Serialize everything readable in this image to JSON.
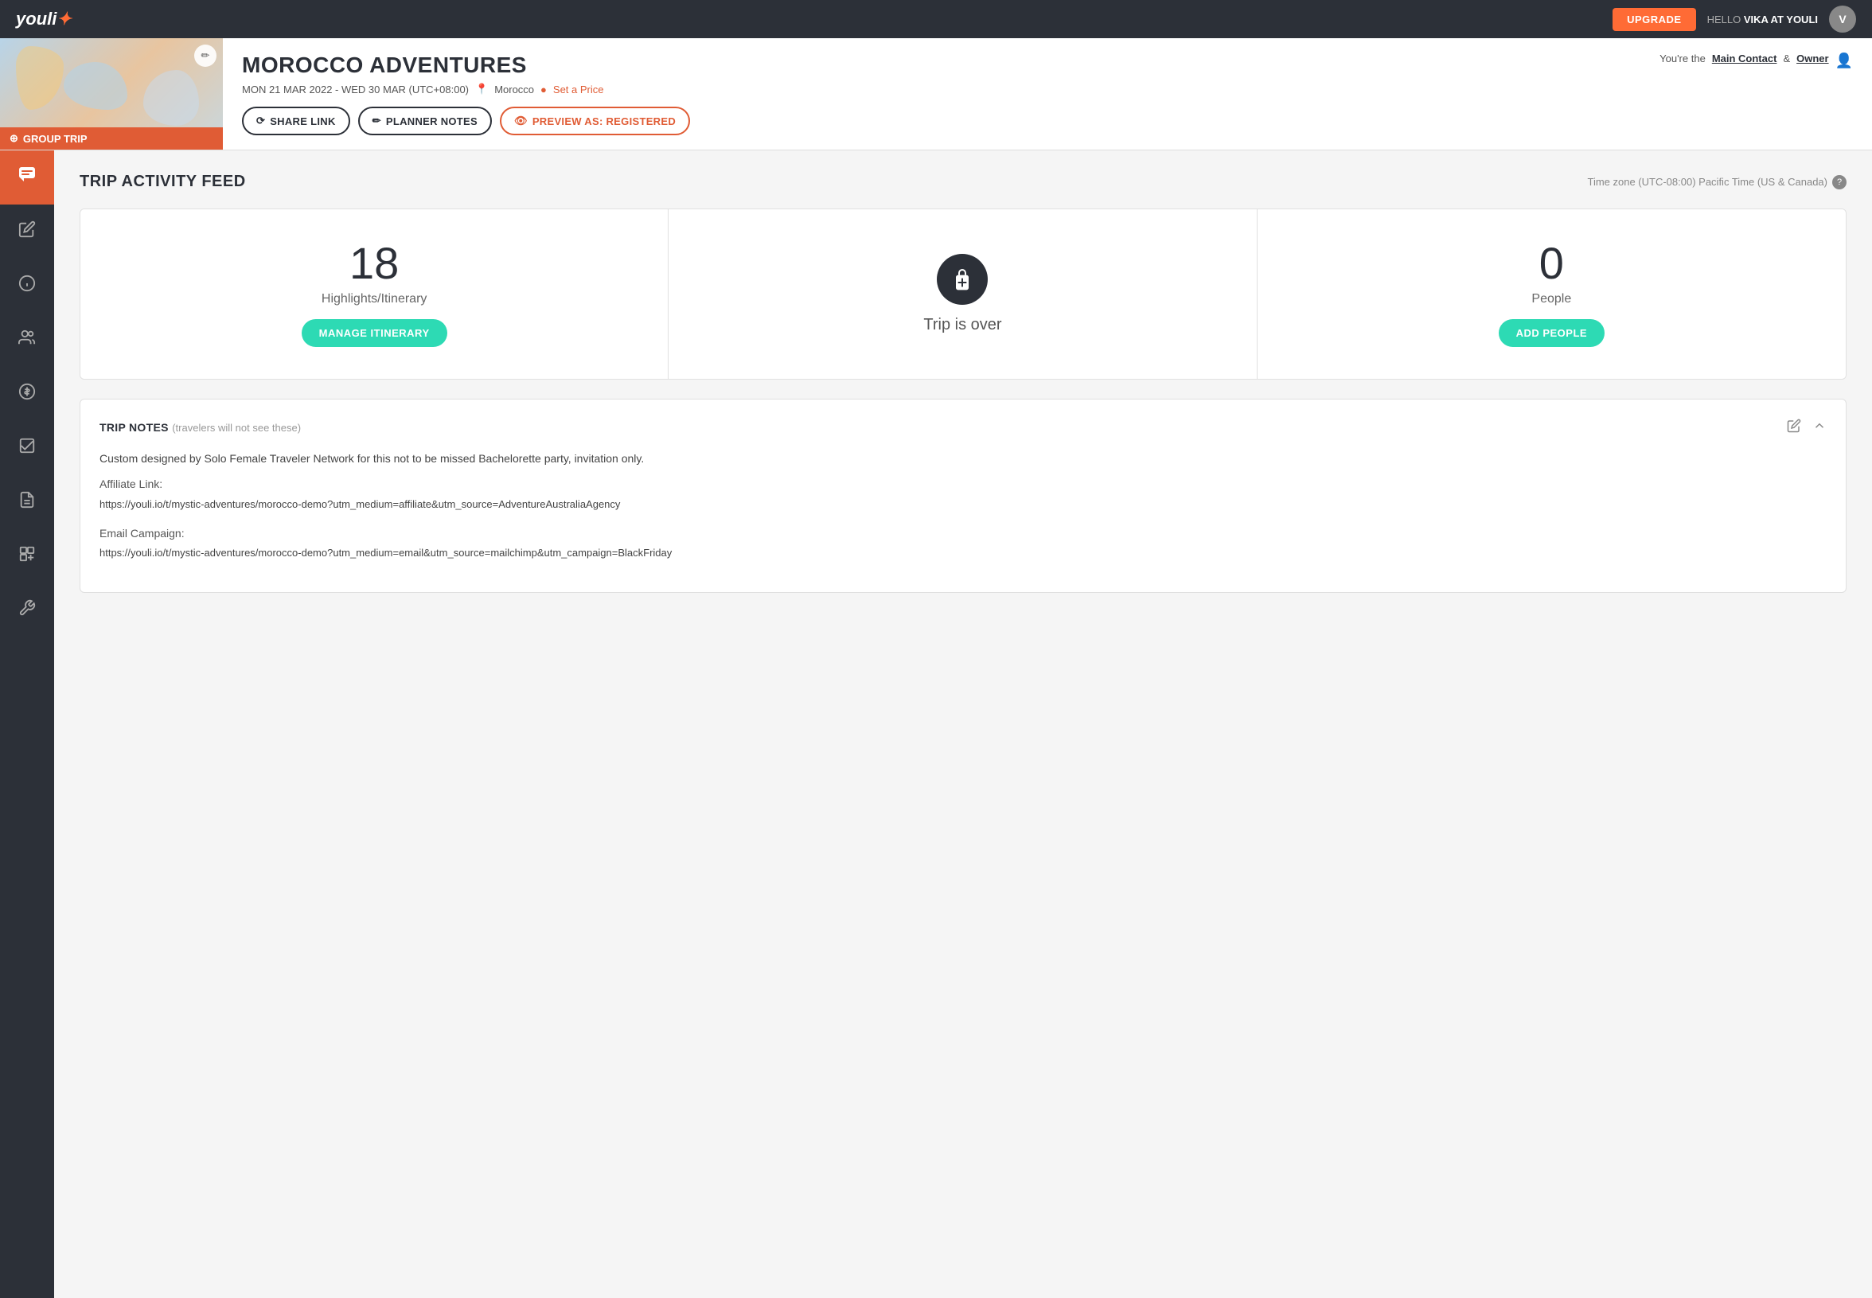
{
  "app": {
    "name": "youli",
    "logo_symbol": "♃"
  },
  "nav": {
    "upgrade_label": "UPGRADE",
    "hello_prefix": "HELLO ",
    "user_name": "VIKA AT YOULI"
  },
  "trip": {
    "title": "MOROCCO ADVENTURES",
    "dates": "MON 21 MAR 2022 - WED 30 MAR (UTC+08:00)",
    "location": "Morocco",
    "set_price_label": "Set a Price",
    "owner_text_prefix": "You're the ",
    "main_contact_label": "Main Contact",
    "owner_label": "Owner",
    "share_link_label": "SHARE LINK",
    "planner_notes_label": "PLANNER NOTES",
    "preview_label": "PREVIEW AS: REGISTERED",
    "group_trip_label": "GROUP TRIP"
  },
  "sidebar": {
    "items": [
      {
        "icon": "💬",
        "name": "activity-feed",
        "active": true
      },
      {
        "icon": "✏️",
        "name": "edit"
      },
      {
        "icon": "ℹ️",
        "name": "info"
      },
      {
        "icon": "👥",
        "name": "people"
      },
      {
        "icon": "$",
        "name": "pricing"
      },
      {
        "icon": "✓",
        "name": "tasks"
      },
      {
        "icon": "📄",
        "name": "documents"
      },
      {
        "icon": "🏷",
        "name": "tags"
      },
      {
        "icon": "🔧",
        "name": "settings"
      }
    ]
  },
  "content": {
    "section_title": "TRIP ACTIVITY FEED",
    "timezone_label": "Time zone (UTC-08:00) Pacific Time (US & Canada)",
    "stats": [
      {
        "number": "18",
        "label": "Highlights/Itinerary",
        "button_label": "MANAGE ITINERARY",
        "type": "number"
      },
      {
        "icon": "🧳",
        "status": "Trip is over",
        "type": "status"
      },
      {
        "number": "0",
        "label": "People",
        "button_label": "ADD PEOPLE",
        "type": "number"
      }
    ],
    "notes": {
      "title": "TRIP NOTES",
      "subtitle": "(travelers will not see these)",
      "body": "Custom designed by Solo Female Traveler Network for this not to be missed Bachelorette party, invitation only.",
      "affiliate_label": "Affiliate Link:",
      "affiliate_url": "https://youli.io/t/mystic-adventures/morocco-demo?utm_medium=affiliate&utm_source=AdventureAustraliaAgency",
      "email_campaign_label": "Email Campaign:",
      "email_campaign_url": "https://youli.io/t/mystic-adventures/morocco-demo?utm_medium=email&utm_source=mailchimp&utm_campaign=BlackFriday"
    }
  }
}
